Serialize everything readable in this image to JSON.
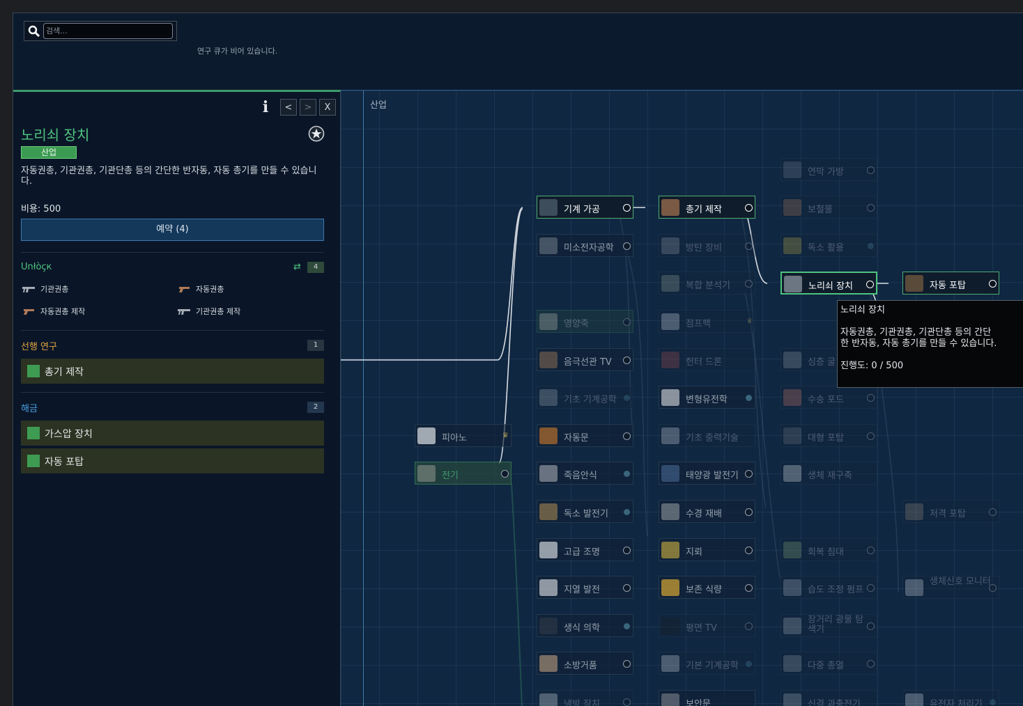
{
  "search": {
    "placeholder": "검색..."
  },
  "queue": {
    "empty_text": "연구 큐가 비어 있습니다."
  },
  "info_panel": {
    "info_glyph": "i",
    "prev_label": "<",
    "next_label": ">",
    "close_label": "X",
    "title": "노리쇠 장치",
    "category": "산업",
    "description": "자동권총, 기관권총, 기관단총 등의 간단한 반자동, 자동 총기를 만들 수 있습니다.",
    "cost": "비용: 500",
    "reserve_label": "예약 (4)",
    "unlock_title": "Unłòçк",
    "unlock_count": "4",
    "unlocks": [
      "기관권총",
      "자동권총",
      "자동권총 제작",
      "기관권총 제작"
    ],
    "prereq_title": "선행 연구",
    "prereq_count": "1",
    "prereqs": [
      "총기 제작"
    ],
    "leads_title": "해금",
    "leads_count": "2",
    "leads": [
      "가스압 장치",
      "자동 포탑"
    ]
  },
  "tree": {
    "category_label": "산업",
    "nodes": [
      {
        "label": "연막 가방",
        "state": "dim",
        "end": "star"
      },
      {
        "label": "기계 가공",
        "state": "bright",
        "end": "star"
      },
      {
        "label": "총기 제작",
        "state": "bright",
        "end": "star"
      },
      {
        "label": "보철물",
        "state": "dim",
        "end": "star"
      },
      {
        "label": "미소전자공학",
        "state": "mid",
        "end": "star"
      },
      {
        "label": "방탄 장비",
        "state": "dim",
        "end": "star"
      },
      {
        "label": "독소 활용",
        "state": "dim",
        "end": "dot"
      },
      {
        "label": "복합 분석기",
        "state": "dim",
        "end": "star"
      },
      {
        "label": "노리쇠 장치",
        "state": "bright",
        "end": "star"
      },
      {
        "label": "자동 포탑",
        "state": "bright",
        "end": "star"
      },
      {
        "label": "영양죽",
        "state": "dim",
        "end": "star"
      },
      {
        "label": "점프팩",
        "state": "dim",
        "end": "crown"
      },
      {
        "label": "음극선관 TV",
        "state": "mid",
        "end": "star"
      },
      {
        "label": "헌터 드론",
        "state": "dim",
        "end": "none"
      },
      {
        "label": "심층 굴",
        "state": "dim",
        "end": "none"
      },
      {
        "label": "기초 기계공학",
        "state": "dim",
        "end": "dot"
      },
      {
        "label": "변형유전학",
        "state": "mid",
        "end": "dot"
      },
      {
        "label": "수송 포드",
        "state": "dim",
        "end": "star"
      },
      {
        "label": "피아노",
        "state": "mid",
        "end": "crown"
      },
      {
        "label": "자동문",
        "state": "mid",
        "end": "star"
      },
      {
        "label": "기초 중력기술",
        "state": "dim",
        "end": "none"
      },
      {
        "label": "대형 포탑",
        "state": "dim",
        "end": "star"
      },
      {
        "label": "전기",
        "state": "green",
        "end": "star"
      },
      {
        "label": "죽음안식",
        "state": "mid",
        "end": "dot"
      },
      {
        "label": "태양광 발전기",
        "state": "mid",
        "end": "star"
      },
      {
        "label": "생체 재구축",
        "state": "dim",
        "end": "none"
      },
      {
        "label": "독소 발전기",
        "state": "mid",
        "end": "dot"
      },
      {
        "label": "수경 재배",
        "state": "mid",
        "end": "star"
      },
      {
        "label": "저격 포탑",
        "state": "dim",
        "end": "star"
      },
      {
        "label": "고급 조명",
        "state": "mid",
        "end": "star"
      },
      {
        "label": "지뢰",
        "state": "mid",
        "end": "star"
      },
      {
        "label": "회복 침대",
        "state": "dim",
        "end": "star"
      },
      {
        "label": "지열 발전",
        "state": "mid",
        "end": "star"
      },
      {
        "label": "보존 식량",
        "state": "mid",
        "end": "star"
      },
      {
        "label": "습도 조정 펌프",
        "state": "dim",
        "end": "star"
      },
      {
        "label": "생체신호 모니터",
        "state": "dim",
        "end": "star"
      },
      {
        "label": "생식 의학",
        "state": "mid",
        "end": "dot"
      },
      {
        "label": "평면 TV",
        "state": "dim",
        "end": "star"
      },
      {
        "label": "장거리 광물 탐색기",
        "state": "dim",
        "end": "star"
      },
      {
        "label": "소방거품",
        "state": "mid",
        "end": "star"
      },
      {
        "label": "기본 기계공학",
        "state": "dim",
        "end": "dot"
      },
      {
        "label": "다중 총열",
        "state": "dim",
        "end": "star"
      },
      {
        "label": "냉방 장치",
        "state": "dim",
        "end": "star"
      },
      {
        "label": "보안문",
        "state": "mid",
        "end": "none"
      },
      {
        "label": "신경 과충전기",
        "state": "dim",
        "end": "none"
      },
      {
        "label": "유전자 처리기",
        "state": "dim",
        "end": "dot"
      }
    ]
  },
  "tooltip": {
    "title": "노리쇠 장치",
    "description": "자동권총, 기관권총, 기관단총 등의 간단한 반자동, 자동 총기를 만들 수 있습니다.",
    "progress": "진행도: 0 / 500"
  },
  "colors": {
    "accent_green": "#4fc47e",
    "prereq_orange": "#e3a540",
    "leads_blue": "#4a9ee0",
    "tree_bg": "#102742"
  }
}
